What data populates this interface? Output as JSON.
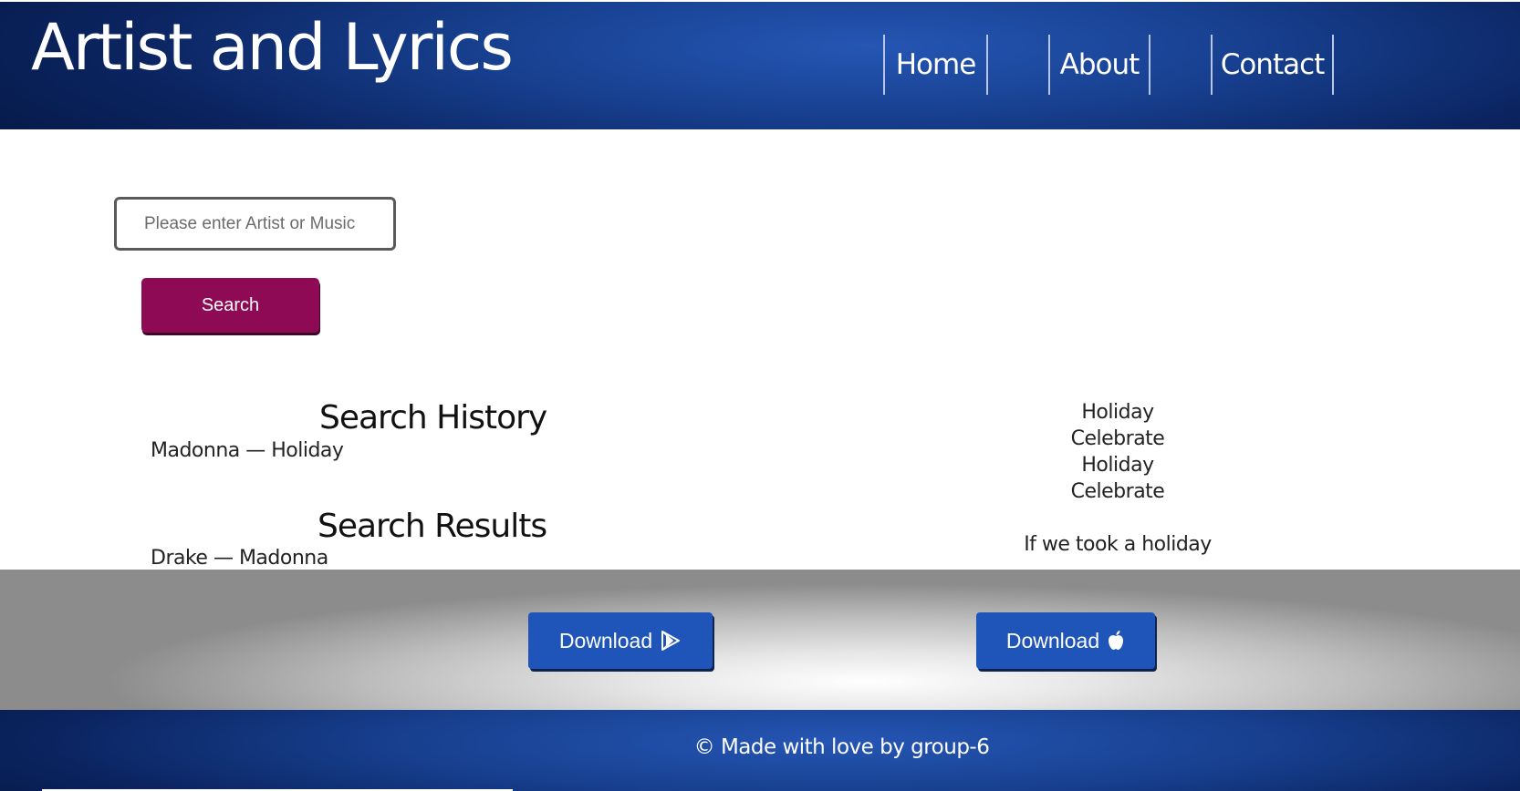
{
  "header": {
    "title": "Artist and Lyrics",
    "nav": {
      "home": "Home",
      "about": "About",
      "contact": "Contact"
    }
  },
  "search": {
    "placeholder": "Please enter Artist or Music",
    "value": "",
    "button_label": "Search"
  },
  "history": {
    "heading": "Search History",
    "entry": "Madonna — Holiday"
  },
  "results": {
    "heading": "Search Results",
    "entry": "Drake — Madonna"
  },
  "lyrics": {
    "lines": [
      "Holiday",
      "Celebrate",
      "Holiday",
      "Celebrate",
      "",
      "If we took a holiday"
    ]
  },
  "downloads": {
    "android_label": "Download",
    "android_icon": "play-store-icon",
    "apple_label": "Download",
    "apple_icon": "apple-icon"
  },
  "footer": {
    "text": "© Made with love by group-6"
  },
  "colors": {
    "header_blue": "#173f8e",
    "search_button": "#8e0a55",
    "download_button": "#1f55b8"
  }
}
